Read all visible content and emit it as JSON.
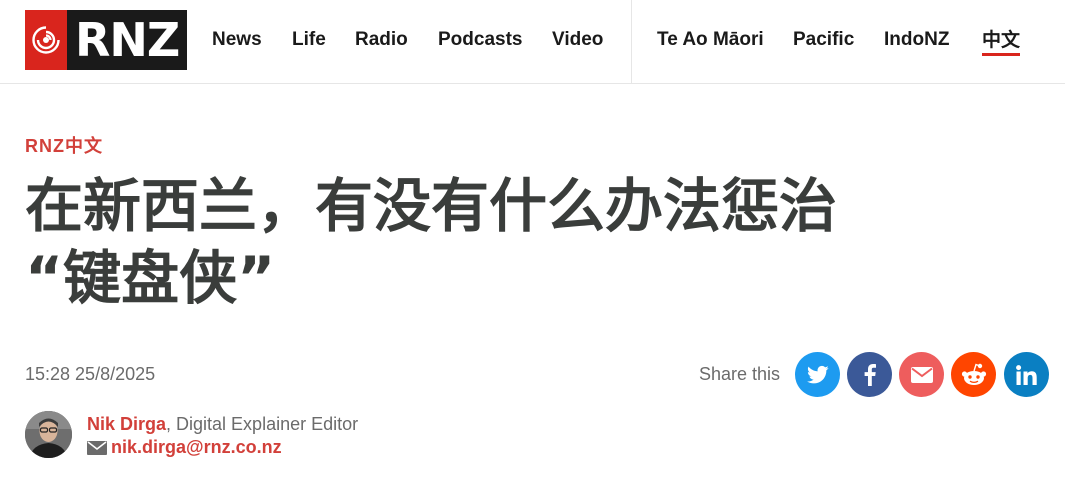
{
  "header": {
    "logo_text": "RNZ",
    "nav_main": [
      "News",
      "Life",
      "Radio",
      "Podcasts",
      "Video"
    ],
    "nav_secondary": [
      "Te Ao Māori",
      "Pacific",
      "IndoNZ",
      "中文"
    ],
    "active_item": "中文"
  },
  "article": {
    "section": "RNZ中文",
    "headline_line1": "在新西兰，有没有什么办法惩治",
    "headline_line2": "“键盘侠”",
    "timestamp": "15:28 25/8/2025"
  },
  "share": {
    "label": "Share this",
    "buttons": [
      {
        "name": "twitter",
        "color": "#1d9bf0"
      },
      {
        "name": "facebook",
        "color": "#3b5998"
      },
      {
        "name": "email",
        "color": "#ee5d5d"
      },
      {
        "name": "reddit",
        "color": "#ff4500"
      },
      {
        "name": "linkedin",
        "color": "#0a7fc2"
      }
    ]
  },
  "author": {
    "name": "Nik Dirga",
    "role": ", Digital Explainer Editor",
    "email": "nik.dirga@rnz.co.nz"
  },
  "colors": {
    "accent": "#d2403a",
    "logo_red": "#d9251d",
    "headline": "#3a3d3b"
  }
}
